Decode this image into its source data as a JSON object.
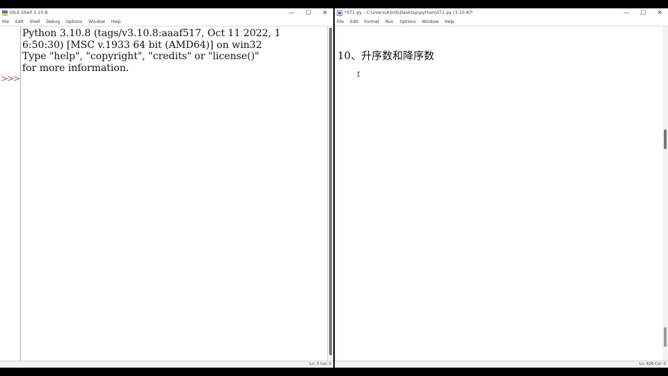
{
  "shell": {
    "title": "IDLE Shell 3.10.8",
    "menu": [
      "File",
      "Edit",
      "Shell",
      "Debug",
      "Options",
      "Window",
      "Help"
    ],
    "output": "Python 3.10.8 (tags/v3.10.8:aaaf517, Oct 11 2022, 1\n6:50:30) [MSC v.1933 64 bit (AMD64)] on win32\nType \"help\", \"copyright\", \"credits\" or \"license()\"\nfor more information.",
    "prompt": ">>>",
    "status": "Ln: 3   Col: 0"
  },
  "editor": {
    "title": "*ST1.py - C:\\Users\\ASUS\\Desktop\\python\\ST1.py (3.10.8)*",
    "menu": [
      "File",
      "Edit",
      "Format",
      "Run",
      "Options",
      "Window",
      "Help"
    ],
    "line1": "10、升序数和降序数",
    "cursor": "I",
    "status": "Ln: 626   Col: 0"
  },
  "controls": {
    "minimize": "—",
    "maximize": "☐",
    "close": "✕"
  }
}
